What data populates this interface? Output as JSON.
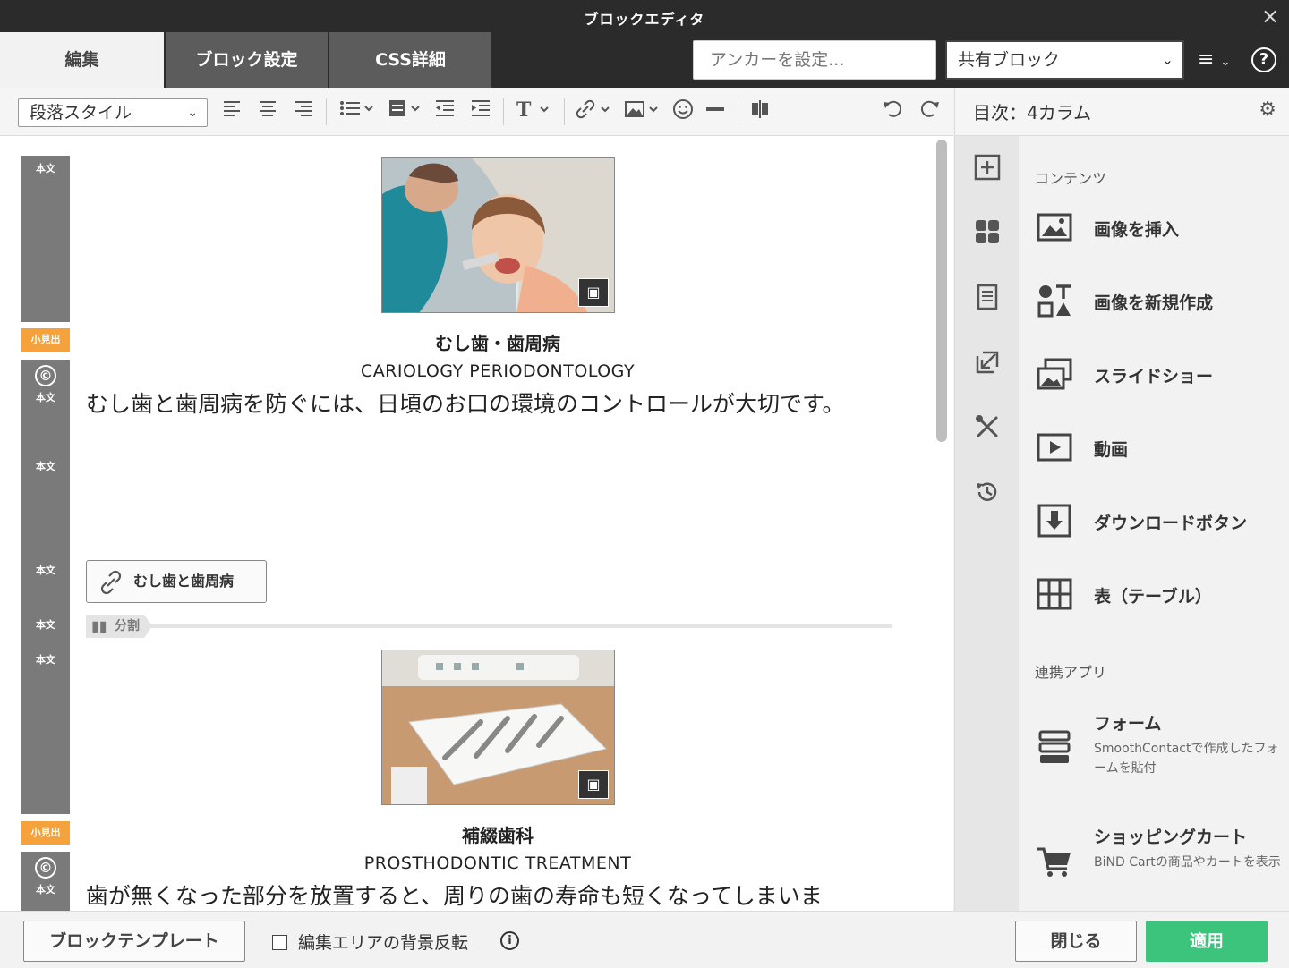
{
  "window": {
    "title": "ブロックエディタ",
    "close_icon": "×"
  },
  "tabs": [
    {
      "label": "編集"
    },
    {
      "label": "ブロック設定"
    },
    {
      "label": "CSS詳細"
    }
  ],
  "header": {
    "anchor_placeholder": "アンカーを設定...",
    "shared_block": "共有ブロック",
    "menu_icon": "≡",
    "help_icon": "?"
  },
  "toolbar": {
    "paragraph_style": "段落スタイル"
  },
  "right_panel": {
    "title": "目次：4カラム",
    "section_contents": "コンテンツ",
    "section_apps": "連携アプリ",
    "items": [
      {
        "label": "画像を挿入"
      },
      {
        "label": "画像を新規作成"
      },
      {
        "label": "スライドショー"
      },
      {
        "label": "動画"
      },
      {
        "label": "ダウンロードボタン"
      },
      {
        "label": "表（テーブル）"
      }
    ],
    "apps": [
      {
        "label": "フォーム",
        "desc": "SmoothContactで作成したフォームを貼付"
      },
      {
        "label": "ショッピングカート",
        "desc": "BiND Cartの商品やカートを表示"
      }
    ]
  },
  "editor": {
    "gutter_labels": {
      "body": "本文",
      "small_heading": "小見出",
      "copyright": "©"
    },
    "block1": {
      "heading": "むし歯・歯周病",
      "subtitle": "CARIOLOGY PERIODONTOLOGY",
      "text": "むし歯と歯周病を防ぐには、日頃のお口の環境のコントロールが大切です。",
      "link_label": "むし歯と歯周病"
    },
    "split_label": "分割",
    "block2": {
      "heading": "補綴歯科",
      "subtitle": "PROSTHODONTIC TREATMENT",
      "text": "歯が無くなった部分を放置すると、周りの歯の寿命も短くなってしまいま"
    }
  },
  "footer": {
    "template_button": "ブロックテンプレート",
    "invert_bg_label": "編集エリアの背景反転",
    "info_icon": "i",
    "close_button": "閉じる",
    "apply_button": "適用"
  },
  "colors": {
    "accent_green": "#3cc47c",
    "tag_orange": "#f5a23c",
    "titlebar": "#2b2b2b"
  }
}
